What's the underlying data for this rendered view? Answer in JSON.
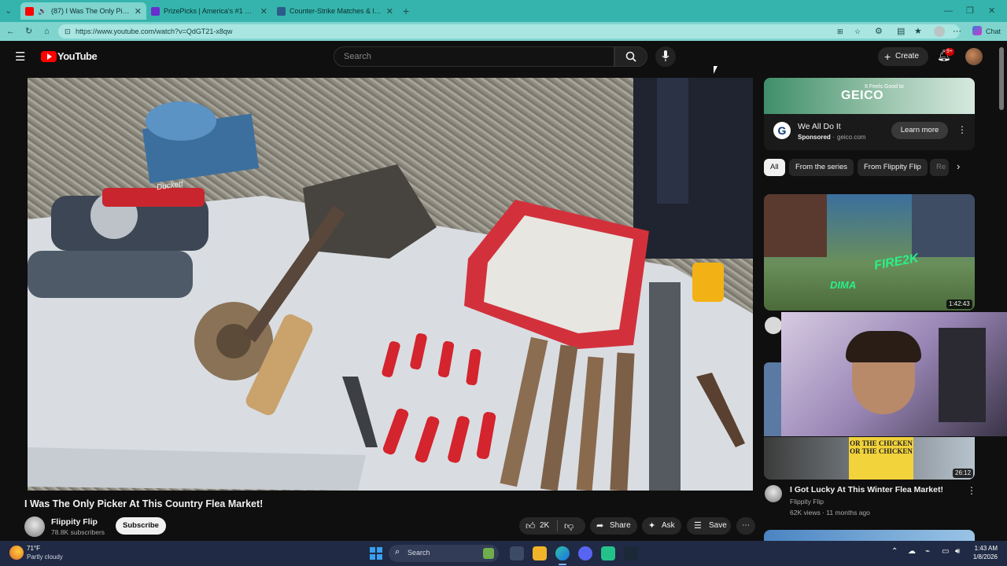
{
  "browser": {
    "tabs": [
      {
        "title": "(87) I Was The Only Picker At",
        "active": true
      },
      {
        "title": "PrizePicks | America's #1 Fantasy S",
        "active": false
      },
      {
        "title": "Counter-Strike Matches & livescor",
        "active": false
      }
    ],
    "url": "https://www.youtube.com/watch?v=QdGT21-x8qw",
    "chat_label": "Chat"
  },
  "youtube": {
    "logo_text": "YouTube",
    "search_placeholder": "Search",
    "create_label": "Create",
    "notif_badge": "9+"
  },
  "video": {
    "title": "I Was The Only Picker At This Country Flea Market!",
    "channel": "Flippity Flip",
    "subscribers": "78.8K subscribers",
    "subscribe_label": "Subscribe",
    "likes": "2K",
    "share_label": "Share",
    "ask_label": "Ask",
    "save_label": "Save",
    "overlay_text": "Duckett"
  },
  "ad": {
    "banner_text": "GEICO",
    "banner_tag": "It Feels Good to",
    "title": "We All Do It",
    "sponsored": "Sponsored",
    "domain": "geico.com",
    "cta": "Learn more"
  },
  "chips": [
    "All",
    "From the series",
    "From Flippity Flip",
    "Re"
  ],
  "sidebar_videos": [
    {
      "duration": "1:42:43",
      "overlay1": "FIRE2K",
      "overlay2": "DIMA"
    },
    {
      "duration": "26:12",
      "title": "I Got Lucky At This Winter Flea Market!",
      "channel": "Flippity Flip",
      "meta": "62K views · 11 months ago",
      "thumb_text": "OR THE CHICKEN OR THE CHICKEN"
    }
  ],
  "taskbar": {
    "weather_temp": "71°F",
    "weather_desc": "Partly cloudy",
    "search_label": "Search",
    "time": "1:43 AM",
    "date": "1/8/2026"
  },
  "colors": {
    "tabbar": "#35b4ad",
    "addressbar": "#7fd4ce",
    "youtube_red": "#ff0000",
    "taskbar": "#202a44"
  }
}
